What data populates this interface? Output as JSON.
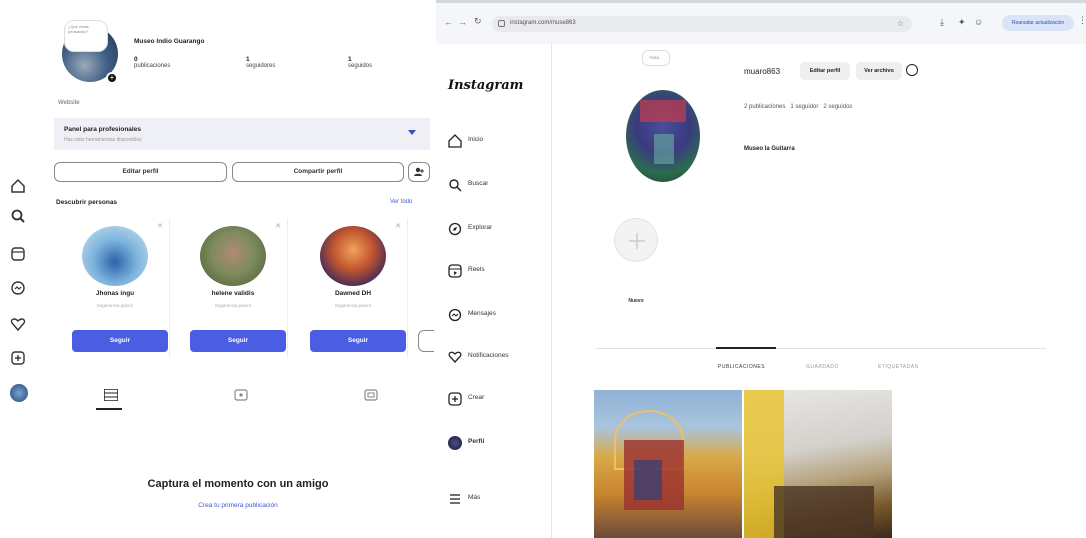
{
  "mobile": {
    "profile": {
      "note_text": "¿Qué estás pensando?",
      "name": "Museo Indio Guarango",
      "stats": [
        {
          "value": "0",
          "label": "publicaciones"
        },
        {
          "value": "1",
          "label": "seguidores"
        },
        {
          "value": "1",
          "label": "seguidos"
        }
      ],
      "category": "Website"
    },
    "dashboard": {
      "title": "Panel para profesionales",
      "subtitle": "Has visto herramientas disponibles"
    },
    "buttons": {
      "edit": "Editar perfil",
      "share": "Compartir perfil"
    },
    "discover": {
      "title": "Descubrir personas",
      "see_all": "Ver todo",
      "cards": [
        {
          "name": "Jhonas ingu",
          "sub": "Sugerencia para ti",
          "action": "Seguir"
        },
        {
          "name": "helene validis",
          "sub": "Sugerencia para ti",
          "action": "Seguir"
        },
        {
          "name": "Dawned DH",
          "sub": "Sugerencia para ti",
          "action": "Seguir"
        }
      ]
    },
    "empty_state": {
      "title": "Captura el momento con un amigo",
      "link": "Crea tu primera publicación"
    },
    "rail_icons": [
      "home-icon",
      "search-icon",
      "reels-icon",
      "messenger-icon",
      "heart-icon",
      "add-icon",
      "avatar-icon"
    ]
  },
  "browser": {
    "url": "instagram.com/muse863",
    "profile_button": "Reanudar actualización",
    "ig": {
      "logo": "Instagram",
      "nav": [
        {
          "label": "Inicio",
          "icon": "home-icon"
        },
        {
          "label": "Buscar",
          "icon": "search-icon"
        },
        {
          "label": "Explorar",
          "icon": "explore-icon"
        },
        {
          "label": "Reels",
          "icon": "reels-icon"
        },
        {
          "label": "Mensajes",
          "icon": "messenger-icon"
        },
        {
          "label": "Notificaciones",
          "icon": "heart-icon"
        },
        {
          "label": "Crear",
          "icon": "add-icon"
        },
        {
          "label": "Perfil",
          "icon": "profile-icon"
        },
        {
          "label": "Más",
          "icon": "menu-icon"
        }
      ],
      "profile": {
        "note": "Nota...",
        "username": "muaro863",
        "edit_button": "Editar perfil",
        "archive_button": "Ver archivo",
        "stats": "2 publicaciones   1 seguidor   2 seguidos",
        "name": "Museo la Guitarra",
        "highlight_label": "Nuevo"
      },
      "tabs": [
        "PUBLICACIONES",
        "GUARDADO",
        "ETIQUETADAS"
      ]
    }
  },
  "colors": {
    "follow_blue": "#4a5de3",
    "panel_grey": "#eef0f5"
  }
}
